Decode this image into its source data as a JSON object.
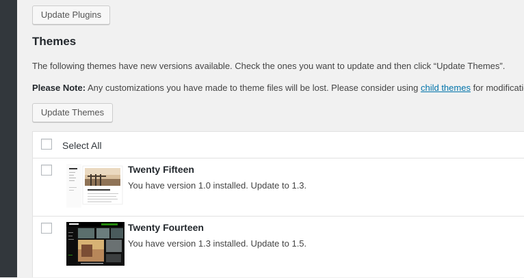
{
  "buttons": {
    "update_plugins": "Update Plugins",
    "update_themes": "Update Themes"
  },
  "themes_section": {
    "title": "Themes",
    "intro": "The following themes have new versions available. Check the ones you want to update and then click “Update Themes”.",
    "note_label": "Please Note:",
    "note_before_link": " Any customizations you have made to theme files will be lost. Please consider using ",
    "note_link": "child themes",
    "note_after_link": " for modifications."
  },
  "table": {
    "select_all": "Select All",
    "rows": [
      {
        "name": "Twenty Fifteen",
        "version_text": "You have version 1.0 installed. Update to 1.3."
      },
      {
        "name": "Twenty Fourteen",
        "version_text": "You have version 1.3 installed. Update to 1.5."
      }
    ]
  },
  "colors": {
    "admin_bar": "#32373c",
    "page_background": "#f1f1f1",
    "link": "#0073aa",
    "twenty_fourteen_accent": "#24890d"
  },
  "icons": {
    "checkbox": "checkbox-unchecked",
    "thumb_1": "twenty-fifteen-screenshot",
    "thumb_2": "twenty-fourteen-screenshot"
  }
}
